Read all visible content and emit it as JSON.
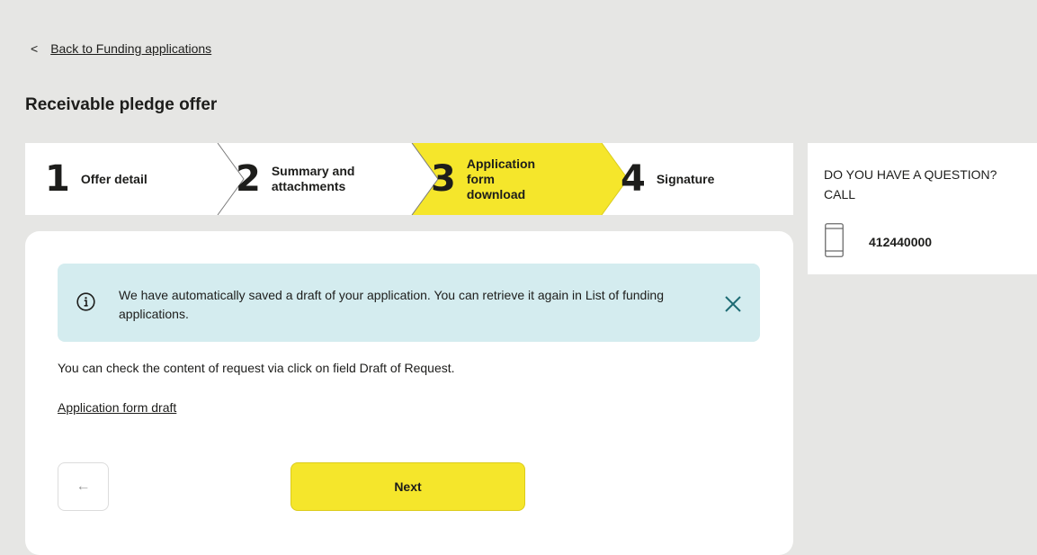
{
  "nav": {
    "back_label": "Back to Funding applications"
  },
  "page": {
    "title": "Receivable pledge offer"
  },
  "stepper": {
    "steps": [
      {
        "number": "1",
        "label": "Offer detail"
      },
      {
        "number": "2",
        "label": "Summary and\nattachments"
      },
      {
        "number": "3",
        "label": "Application\nform\ndownload"
      },
      {
        "number": "4",
        "label": "Signature"
      }
    ],
    "active_step": 3,
    "active_color": "#f5e62b"
  },
  "help": {
    "question": "DO YOU HAVE A QUESTION? CALL",
    "phone": "412440000"
  },
  "banner": {
    "message": "We have automatically saved a draft of your application. You can retrieve it again in  List of funding applications.",
    "background": "#d4ecef",
    "accent": "#1e6b74"
  },
  "content": {
    "check_text": "You can check the content of request via click on field Draft of Request.",
    "draft_link": "Application form draft"
  },
  "actions": {
    "back_arrow": "←",
    "next_label": "Next",
    "next_color": "#f5e62b"
  }
}
